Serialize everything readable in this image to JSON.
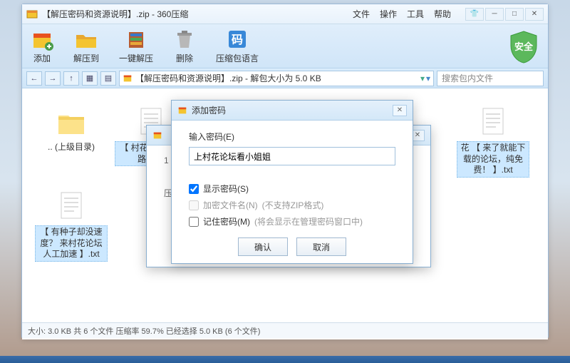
{
  "window": {
    "title": "【解压密码和资源说明】.zip - 360压缩",
    "menus": [
      "文件",
      "操作",
      "工具",
      "帮助"
    ]
  },
  "toolbar": {
    "add": "添加",
    "extract_to": "解压到",
    "one_click": "一键解压",
    "delete": "删除",
    "encoding": "压缩包语言",
    "shield": "安全"
  },
  "path": "【解压密码和资源说明】.zip - 解包大小为 5.0 KB",
  "search_placeholder": "搜索包内文件",
  "files": {
    "up": ".. (上级目录)",
    "f1": "【 村花论坛无套路-更...",
    "f2": "花 【 来了就能下载的论坛，纯免费！ 】.txt",
    "f3": "【 有种子却没速度？ 来村花论坛人工加速 】.txt"
  },
  "status": "大小: 3.0 KB 共 6 个文件 压缩率 59.7% 已经选择 5.0 KB (6 个文件)",
  "dialog1": {
    "title_prefix": "1",
    "line1": "压..."
  },
  "dialog2": {
    "title": "添加密码",
    "label": "输入密码(E)",
    "value": "上村花论坛看小姐姐",
    "show_pw": "显示密码(S)",
    "encrypt_name": "加密文件名(N)",
    "encrypt_hint": "(不支持ZIP格式)",
    "remember": "记住密码(M)",
    "remember_hint": "(将会显示在管理密码窗口中)",
    "ok": "确认",
    "cancel": "取消"
  }
}
